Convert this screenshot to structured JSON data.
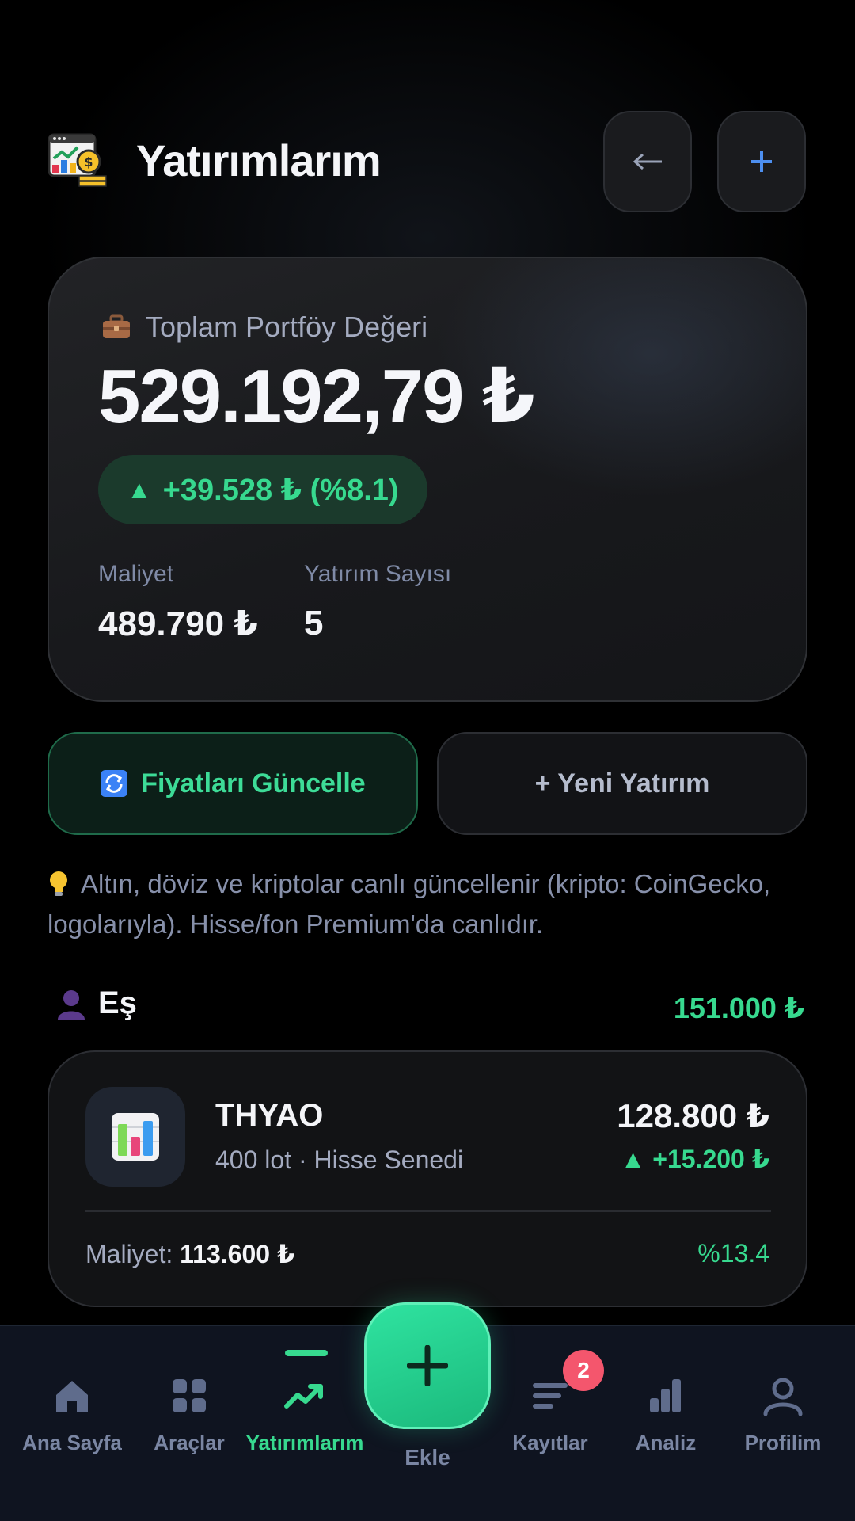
{
  "header": {
    "title": "Yatırımlarım",
    "back_icon": "arrow-left-icon",
    "add_icon": "plus-icon"
  },
  "portfolio": {
    "label": "Toplam Portföy Değeri",
    "value": "529.192,79 ₺",
    "change": "+39.528 ₺ (%8.1)",
    "cost_label": "Maliyet",
    "cost_value": "489.790 ₺",
    "count_label": "Yatırım Sayısı",
    "count_value": "5"
  },
  "actions": {
    "refresh_label": "Fiyatları Güncelle",
    "new_label": "+ Yeni Yatırım"
  },
  "info_text": "Altın, döviz ve kriptolar canlı güncellenir (kripto: CoinGecko, logolarıyla). Hisse/fon Premium'da canlıdır.",
  "group": {
    "name": "Eş",
    "total": "151.000 ₺"
  },
  "investment": {
    "name": "THYAO",
    "subtitle": "400 lot · Hisse Senedi",
    "value": "128.800 ₺",
    "gain": "▲ +15.200 ₺",
    "cost_label": "Maliyet:",
    "cost_value": "113.600 ₺",
    "percent": "%13.4"
  },
  "nav": {
    "items": [
      {
        "label": "Ana Sayfa",
        "icon": "home-icon"
      },
      {
        "label": "Araçlar",
        "icon": "grid-icon"
      },
      {
        "label": "Yatırımlarım",
        "icon": "trend-up-icon"
      },
      {
        "label": "Kayıtlar",
        "icon": "list-icon"
      },
      {
        "label": "Analiz",
        "icon": "bar-chart-icon"
      },
      {
        "label": "Profilim",
        "icon": "user-icon"
      }
    ],
    "fab_label": "Ekle",
    "badge_count": "2"
  },
  "colors": {
    "accent_green": "#37d98f",
    "background": "#000000",
    "card": "#1a1b1e",
    "badge": "#f4566d",
    "nav_bg": "#0f1420"
  }
}
